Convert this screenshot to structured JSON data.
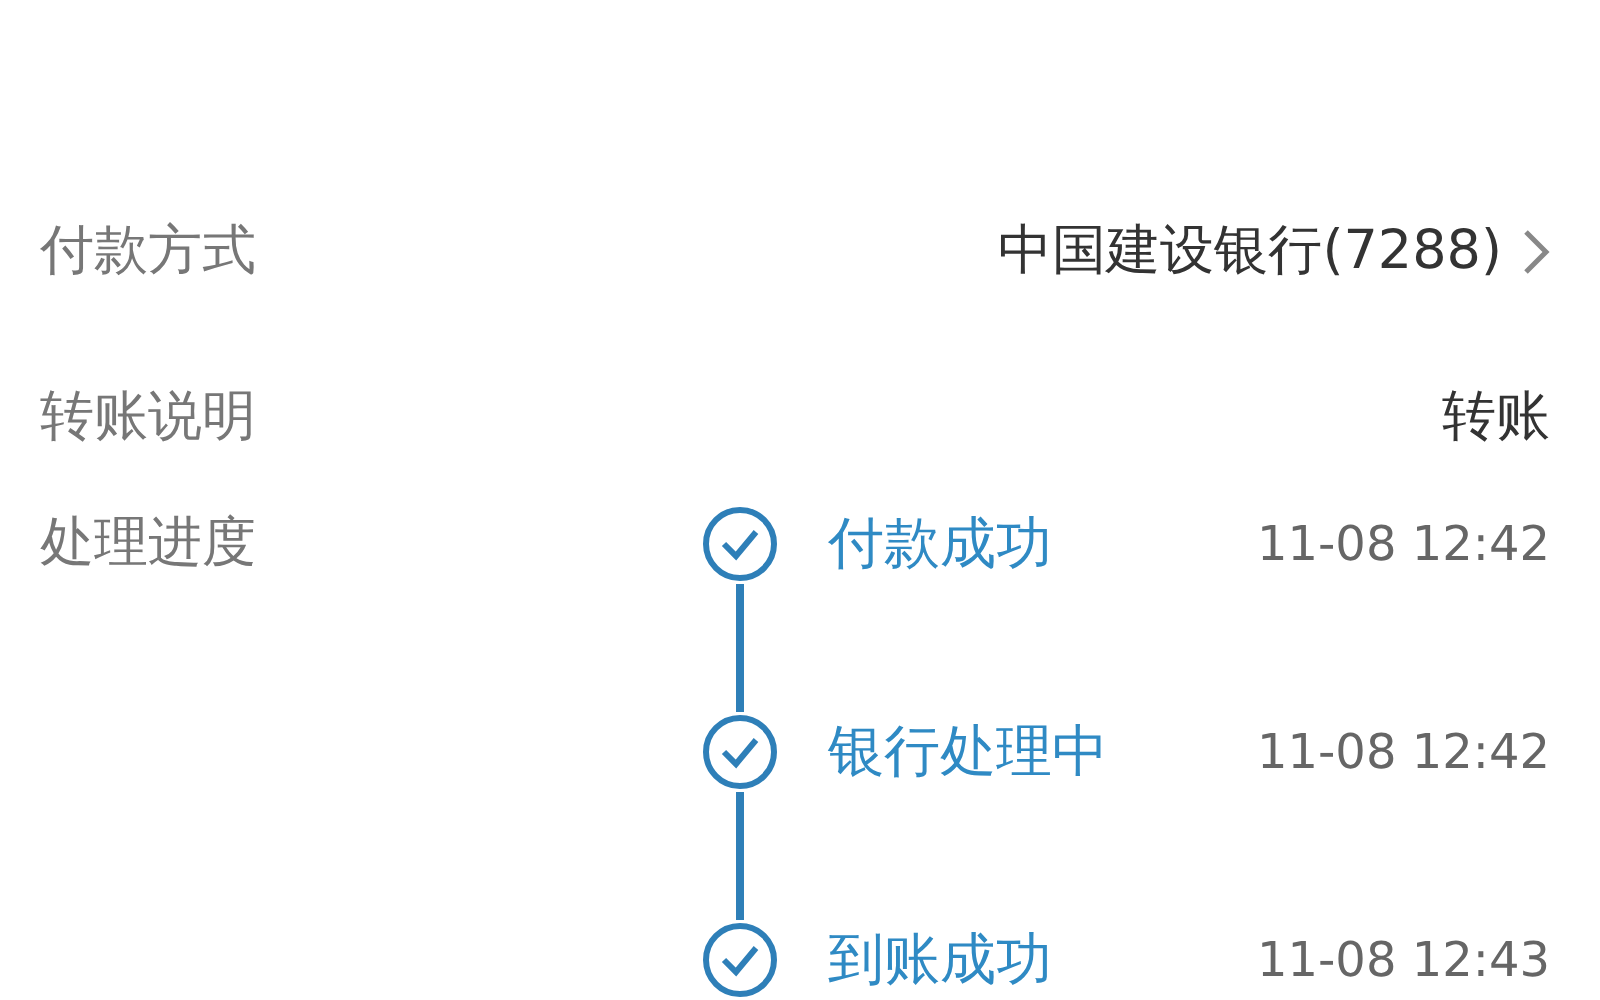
{
  "fields": [
    {
      "label": "付款方式",
      "value": "中国建设银行(7288)",
      "kind": "link"
    },
    {
      "label": "转账说明",
      "value": "转账",
      "kind": "text"
    }
  ],
  "progress": {
    "label": "处理进度",
    "steps": [
      {
        "status": "付款成功",
        "time": "11-08 12:42",
        "completed": true
      },
      {
        "status": "银行处理中",
        "time": "11-08 12:42",
        "completed": true
      },
      {
        "status": "到账成功",
        "time": "11-08 12:43",
        "completed": true
      }
    ]
  }
}
